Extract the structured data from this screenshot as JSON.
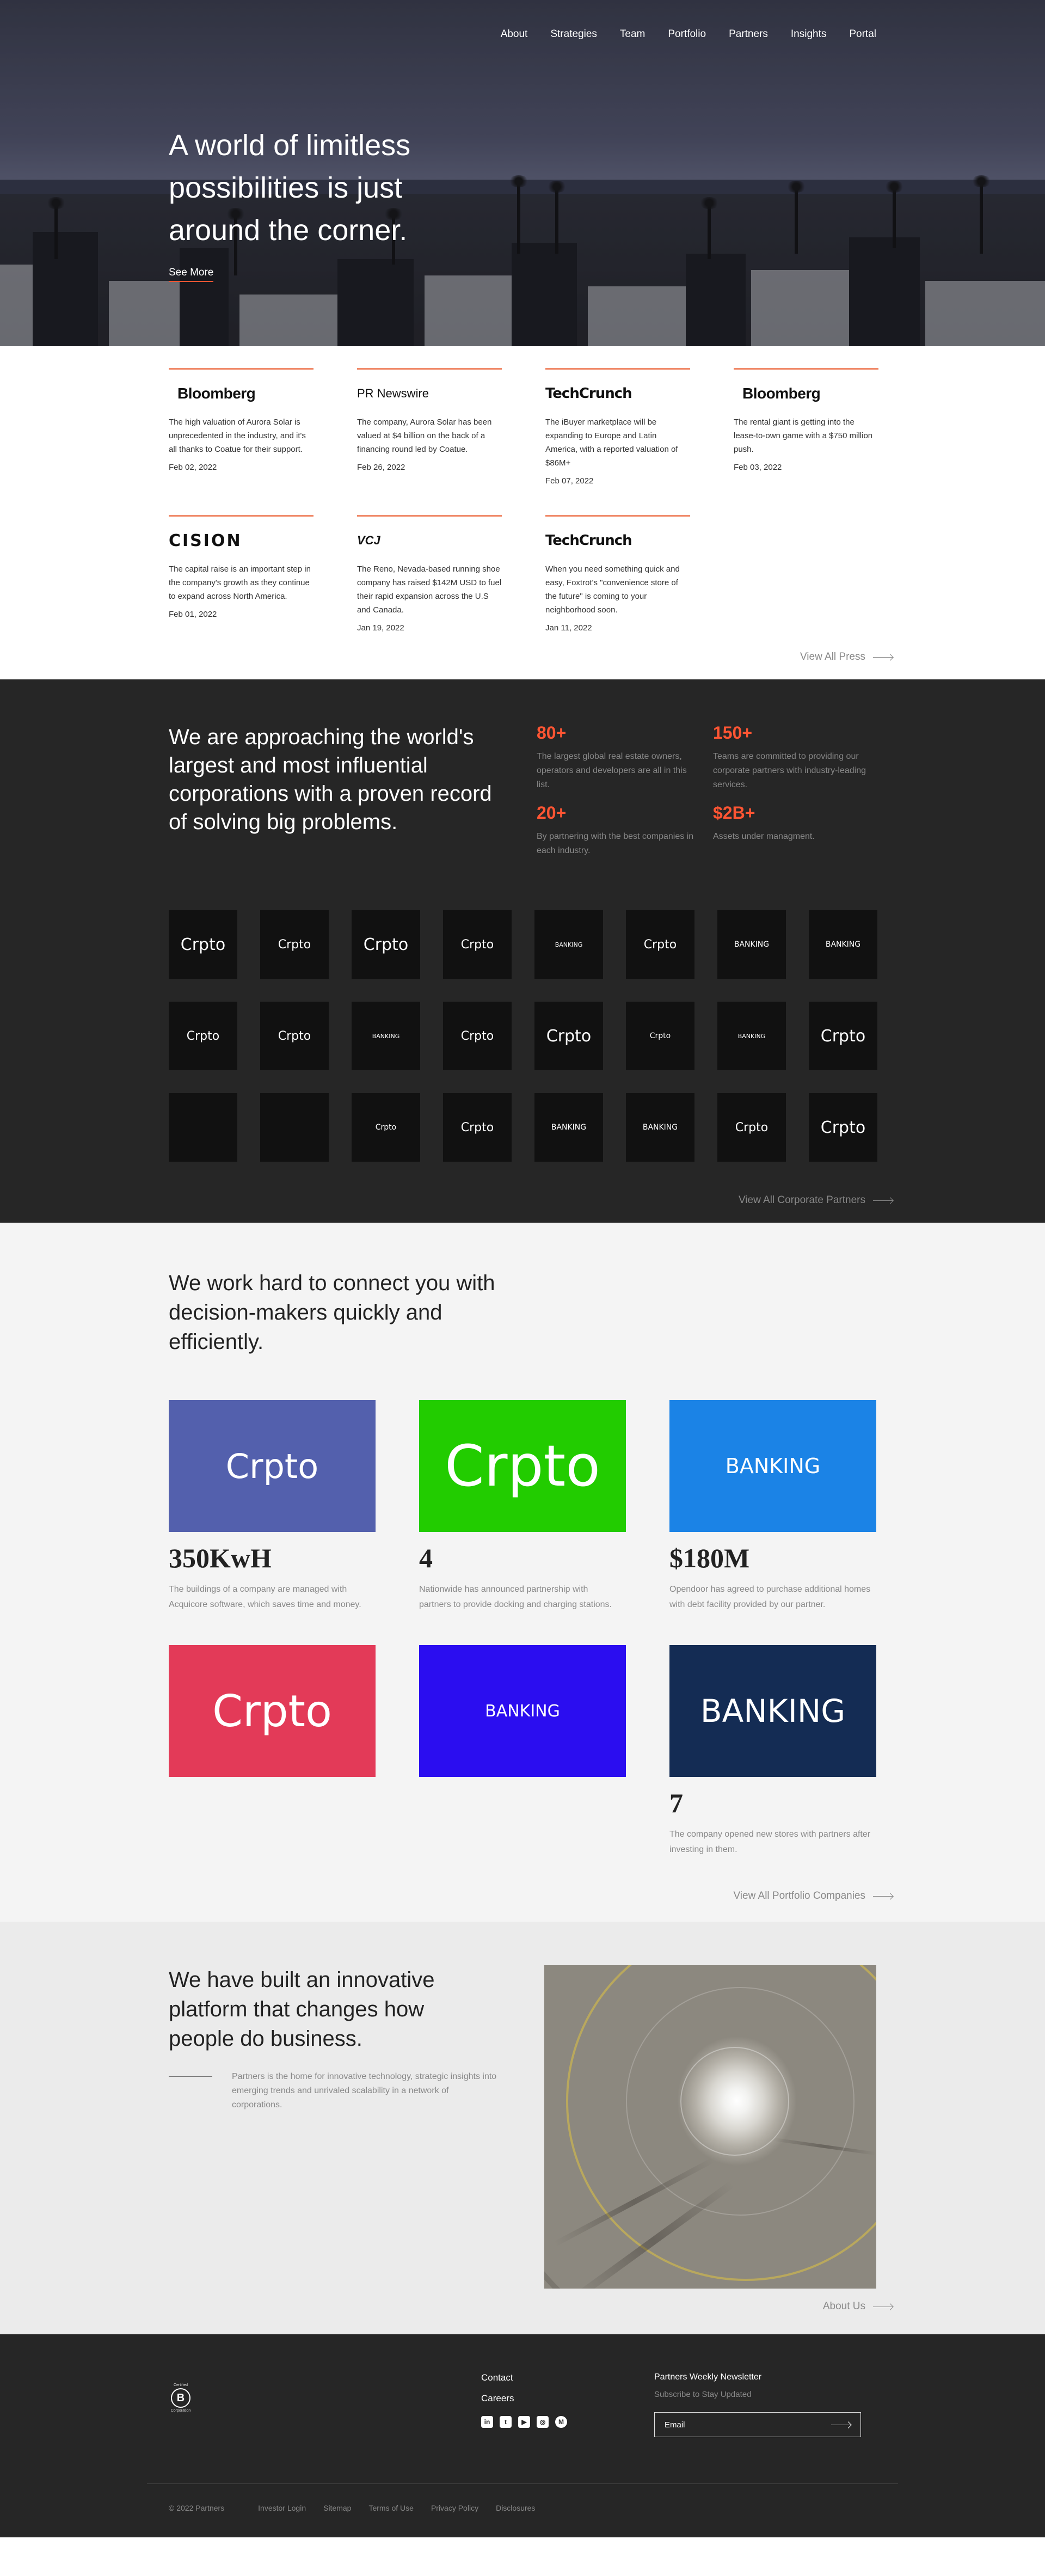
{
  "nav": [
    "About",
    "Strategies",
    "Team",
    "Portfolio",
    "Partners",
    "Insights",
    "Portal"
  ],
  "hero": {
    "headline": "A world of limitless possibilities is just around the corner.",
    "cta": "See More"
  },
  "press": {
    "items": [
      {
        "logo": "Bloomberg",
        "text": "The high valuation of Aurora Solar is unprecedented in the industry, and it's all thanks to Coatue for their support.",
        "date": "Feb 02, 2022"
      },
      {
        "logo": "PR Newswire",
        "text": "The company, Aurora Solar has been valued at $4 billion on the back of a financing round led by Coatue.",
        "date": "Feb 26, 2022"
      },
      {
        "logo": "TechCrunch",
        "text": "The iBuyer marketplace will be expanding to Europe and Latin America, with a reported valuation of $86M+",
        "date": "Feb 07, 2022"
      },
      {
        "logo": "Bloomberg",
        "text": "The rental giant is getting into the lease-to-own game with a $750 million push.",
        "date": "Feb 03, 2022"
      },
      {
        "logo": "CISION",
        "text": "The capital raise is an important step in the company's growth as they continue to expand across North America.",
        "date": "Feb 01, 2022"
      },
      {
        "logo": "VCJ",
        "text": "The Reno, Nevada-based running shoe company has raised $142M USD to fuel their rapid expansion across the U.S and Canada.",
        "date": "Jan 19, 2022"
      },
      {
        "logo": "TechCrunch",
        "text": "When you need something quick and easy, Foxtrot's \"convenience store of the future\" is coming to your neighborhood soon.",
        "date": "Jan 11, 2022"
      }
    ],
    "view_all": "View All Press"
  },
  "corporate": {
    "headline": "We are approaching the world's largest and most influential corporations with a proven record of solving big problems.",
    "stats": [
      {
        "num": "80+",
        "text": "The largest global real estate owners, operators and developers are all in this list."
      },
      {
        "num": "150+",
        "text": "Teams are committed to providing our corporate partners with industry-leading services."
      },
      {
        "num": "20+",
        "text": "By partnering with the best companies in each industry."
      },
      {
        "num": "$2B+",
        "text": "Assets under managment."
      }
    ],
    "partners": [
      {
        "label": "Crpto",
        "size": "big"
      },
      {
        "label": "Crpto",
        "size": "mid"
      },
      {
        "label": "Crpto",
        "size": "big"
      },
      {
        "label": "Crpto",
        "size": "mid"
      },
      {
        "label": "BANKING",
        "size": "tiny"
      },
      {
        "label": "Crpto",
        "size": "mid"
      },
      {
        "label": "BANKING",
        "size": "small"
      },
      {
        "label": "BANKING",
        "size": "small"
      },
      {
        "label": "Crpto",
        "size": "mid"
      },
      {
        "label": "Crpto",
        "size": "mid"
      },
      {
        "label": "BANKING",
        "size": "tiny"
      },
      {
        "label": "Crpto",
        "size": "mid"
      },
      {
        "label": "Crpto",
        "size": "big"
      },
      {
        "label": "Crpto",
        "size": "small"
      },
      {
        "label": "BANKING",
        "size": "tiny"
      },
      {
        "label": "Crpto",
        "size": "big"
      },
      {
        "label": "",
        "size": "mid"
      },
      {
        "label": "",
        "size": "mid"
      },
      {
        "label": "Crpto",
        "size": "small"
      },
      {
        "label": "Crpto",
        "size": "mid"
      },
      {
        "label": "BANKING",
        "size": "small"
      },
      {
        "label": "BANKING",
        "size": "small"
      },
      {
        "label": "Crpto",
        "size": "mid"
      },
      {
        "label": "Crpto",
        "size": "big"
      }
    ],
    "view_all": "View All Corporate Partners"
  },
  "portfolio": {
    "headline": "We work hard to connect you with decision-makers quickly and efficiently.",
    "items": [
      {
        "label": "Crpto",
        "bg": "#5360ad",
        "font": 62,
        "num": "350KwH",
        "text": "The buildings of a company are managed with Acquicore software, which saves time and money."
      },
      {
        "label": "Crpto",
        "bg": "#22cc00",
        "font": 104,
        "num": "4",
        "text": "Nationwide has announced partnership with partners to provide docking and charging stations."
      },
      {
        "label": "BANKING",
        "bg": "#1b83e6",
        "font": 38,
        "num": "$180M",
        "text": "Opendoor has agreed to purchase additional homes with debt facility provided by our partner."
      },
      {
        "label": "Crpto",
        "bg": "#e33a58",
        "font": 80,
        "num": "",
        "text": ""
      },
      {
        "label": "BANKING",
        "bg": "#2b0df0",
        "font": 30,
        "num": "",
        "text": ""
      },
      {
        "label": "BANKING",
        "bg": "#142c54",
        "font": 58,
        "num": "7",
        "text": "The company opened new stores with partners after investing in them."
      }
    ],
    "view_all": "View All Portfolio Companies"
  },
  "platform": {
    "headline": "We have built an innovative platform that changes how people do business.",
    "text": "Partners is the home for innovative technology, strategic insights into emerging trends and unrivaled scalability in a network of corporations.",
    "about": "About Us"
  },
  "footer": {
    "bcorp_top": "Certified",
    "bcorp_letter": "B",
    "bcorp_bottom": "Corporation",
    "links": [
      "Contact",
      "Careers"
    ],
    "socials": [
      {
        "name": "linkedin-icon",
        "glyph": "in",
        "round": false
      },
      {
        "name": "twitter-icon",
        "glyph": "t",
        "round": false
      },
      {
        "name": "youtube-icon",
        "glyph": "▶",
        "round": false
      },
      {
        "name": "instagram-icon",
        "glyph": "◎",
        "round": false
      },
      {
        "name": "medium-icon",
        "glyph": "M",
        "round": true
      }
    ],
    "newsletter_title": "Partners Weekly Newsletter",
    "newsletter_sub": "Subscribe to Stay Updated",
    "email_placeholder": "Email",
    "copyright": "© 2022 Partners",
    "bottom_links": [
      "Investor Login",
      "Sitemap",
      "Terms of Use",
      "Privacy Policy",
      "Disclosures"
    ]
  }
}
